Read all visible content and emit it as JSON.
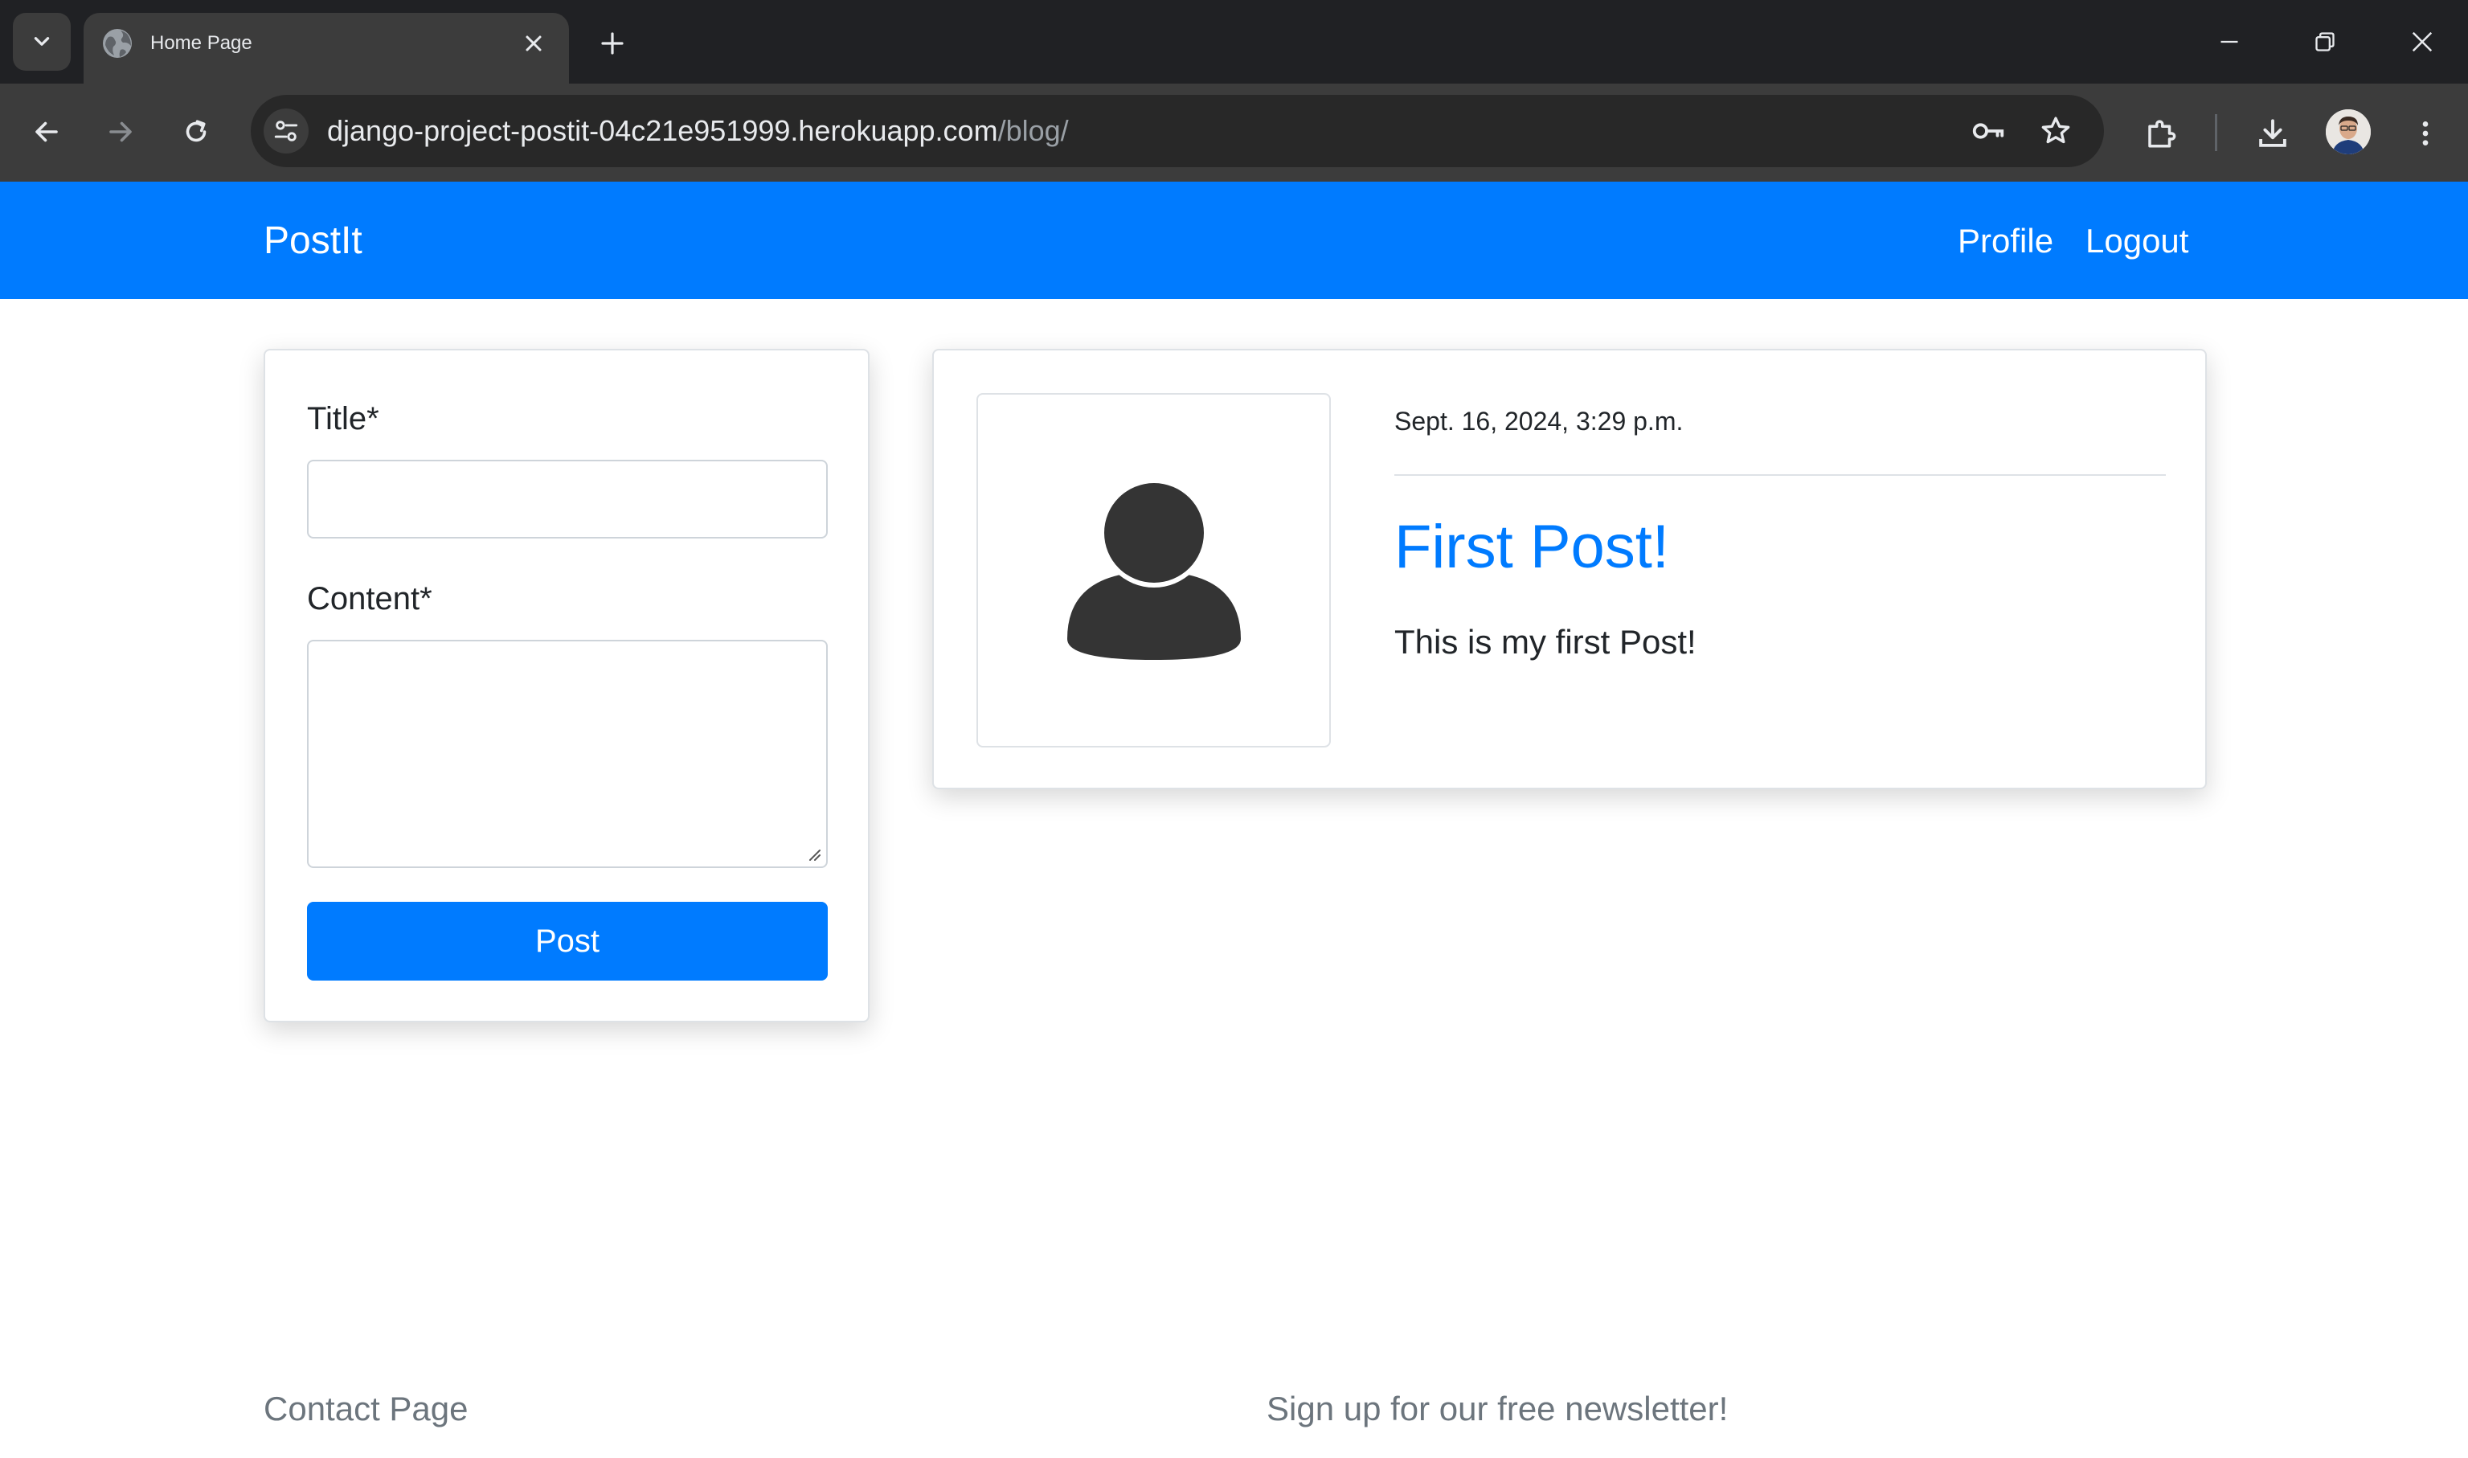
{
  "browser": {
    "tab": {
      "title": "Home Page",
      "favicon": "globe-icon"
    },
    "url": {
      "host": "django-project-postit-04c21e951999.herokuapp.com",
      "path": "/blog/"
    },
    "icons": [
      "tab-search-icon",
      "close-icon",
      "new-tab-icon",
      "minimize-icon",
      "restore-icon",
      "window-close-icon",
      "back-icon",
      "forward-icon",
      "reload-icon",
      "site-info-icon",
      "password-key-icon",
      "bookmark-star-icon",
      "extensions-icon",
      "download-icon",
      "profile-avatar",
      "menu-icon"
    ]
  },
  "navbar": {
    "brand": "PostIt",
    "links": {
      "profile": "Profile",
      "logout": "Logout"
    },
    "color": "#007bff"
  },
  "form": {
    "title_label": "Title*",
    "title_value": "",
    "content_label": "Content*",
    "content_value": "",
    "submit_label": "Post"
  },
  "posts": [
    {
      "date": "Sept. 16, 2024, 3:29 p.m.",
      "title": "First Post!",
      "body": "This is my first Post!",
      "avatar": "user-silhouette-icon"
    }
  ],
  "footer": {
    "contact": "Contact Page",
    "newsletter": "Sign up for our free newsletter!"
  }
}
